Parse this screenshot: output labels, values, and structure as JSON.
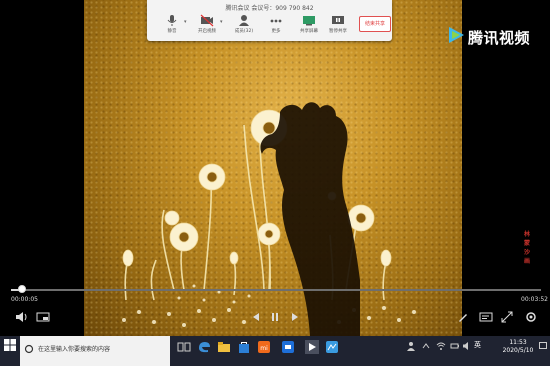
{
  "meeting": {
    "id_text": "腾讯会议 会议号：909 790 842",
    "tools": [
      {
        "label": "静音",
        "icon": "microphone-icon"
      },
      {
        "label": "开启视频",
        "icon": "camera-off-icon"
      },
      {
        "label": "成员(32)",
        "icon": "members-icon"
      },
      {
        "label": "更多",
        "icon": "more-icon"
      },
      {
        "label": "共享屏幕",
        "icon": "share-screen-icon"
      },
      {
        "label": "暂停共享",
        "icon": "pause-share-icon"
      }
    ],
    "end_label": "结束共享"
  },
  "logo": {
    "text": "腾讯视频",
    "icon": "tencent-video-logo"
  },
  "seal": {
    "text": "林 蒙 沙 画"
  },
  "player": {
    "current_time": "00:00:05",
    "total_time": "00:03:52",
    "progress": 0.02
  },
  "taskbar": {
    "search_placeholder": "在这里输入你要搜索的内容",
    "ime": "英",
    "time": "11:53",
    "date": "2020/5/10"
  },
  "colors": {
    "accent": "#e04040",
    "taskbar": "#1f2331",
    "sand": "#c79226"
  }
}
